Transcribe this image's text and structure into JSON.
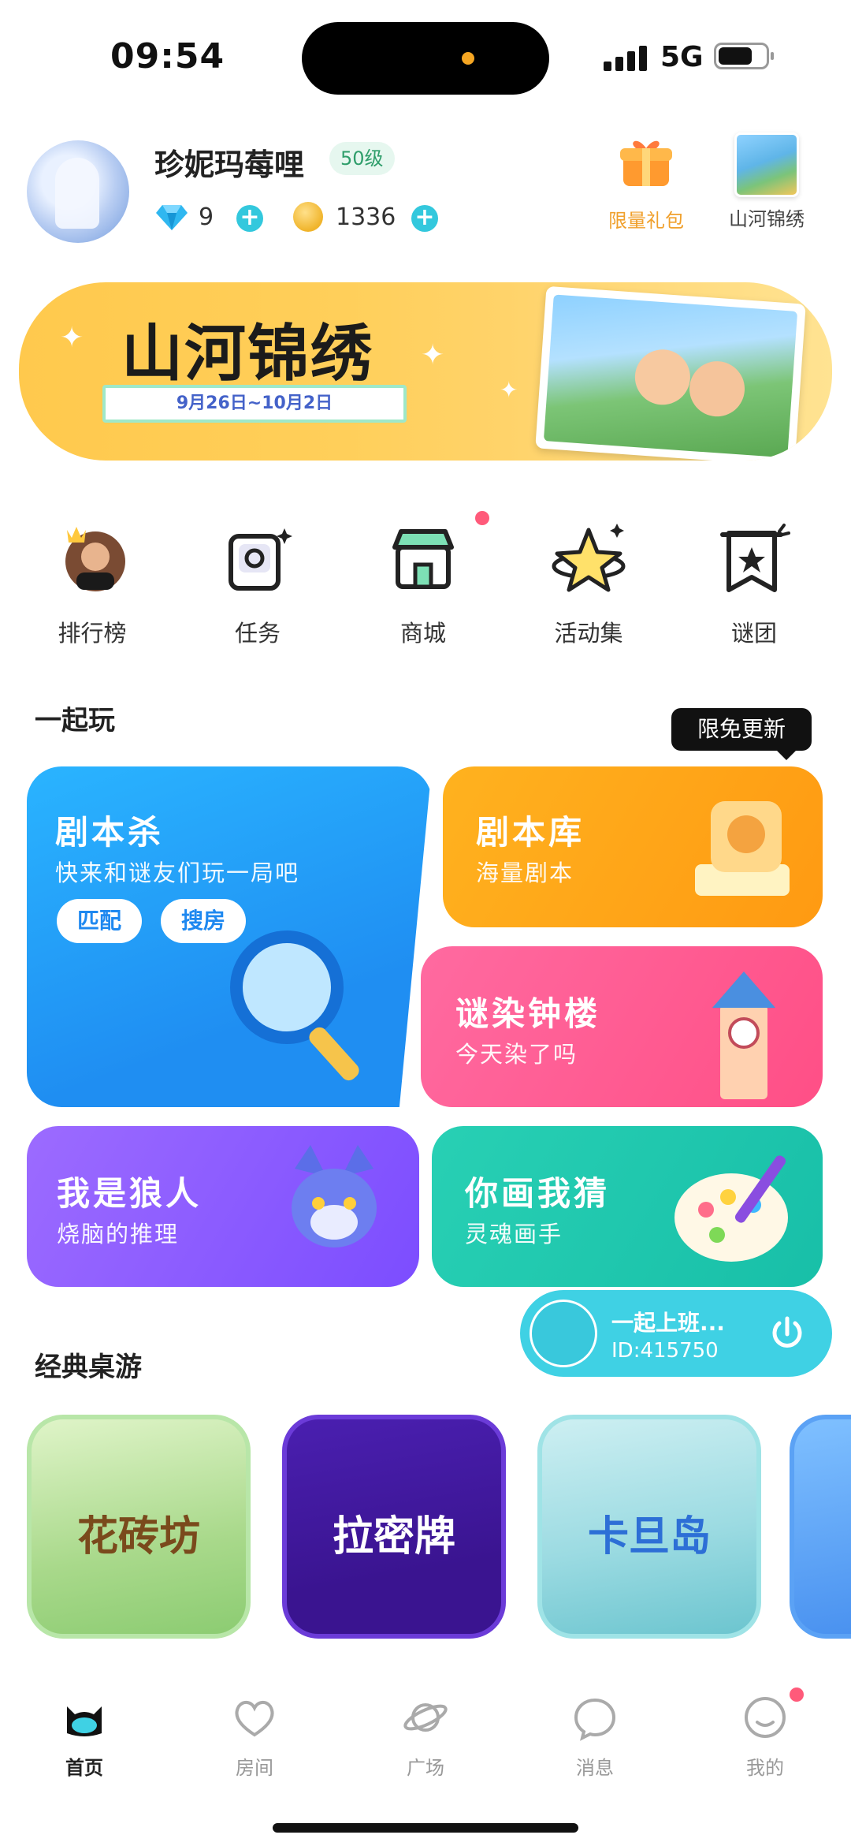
{
  "status_bar": {
    "time": "09:54",
    "network": "5G"
  },
  "profile": {
    "username": "珍妮玛莓哩",
    "level": "50级",
    "gems": "9",
    "coins": "1336",
    "gift_label": "限量礼包",
    "event_label": "山河锦绣"
  },
  "banner": {
    "title": "山河锦绣",
    "date_range": "9月26日~10月2日"
  },
  "quick_links": [
    {
      "label": "排行榜"
    },
    {
      "label": "任务"
    },
    {
      "label": "商城"
    },
    {
      "label": "活动集"
    },
    {
      "label": "谜团"
    }
  ],
  "play_together": {
    "title": "一起玩",
    "tooltip": "限免更新",
    "script_kill": {
      "title": "剧本杀",
      "subtitle": "快来和谜友们玩一局吧",
      "match_label": "匹配",
      "search_label": "搜房"
    },
    "script_library": {
      "title": "剧本库",
      "subtitle": "海量剧本"
    },
    "clock_tower": {
      "title": "谜染钟楼",
      "subtitle": "今天染了吗"
    },
    "werewolf": {
      "title": "我是狼人",
      "subtitle": "烧脑的推理"
    },
    "draw_guess": {
      "title": "你画我猜",
      "subtitle": "灵魂画手"
    }
  },
  "floating_room": {
    "name": "一起上班...",
    "id": "ID:415750"
  },
  "classic": {
    "title": "经典桌游",
    "games": [
      {
        "name": "花砖坊"
      },
      {
        "name": "拉密牌"
      },
      {
        "name": "卡旦岛"
      }
    ]
  },
  "tabs": [
    {
      "label": "首页",
      "active": true
    },
    {
      "label": "房间"
    },
    {
      "label": "广场"
    },
    {
      "label": "消息"
    },
    {
      "label": "我的"
    }
  ],
  "colors": {
    "accent": "#3fd1e4",
    "script_kill": "#2b9cf2",
    "script_library": "#ffa41f",
    "clock_tower": "#ff5d92",
    "werewolf": "#8b5cf6",
    "draw_guess": "#22c7b0"
  }
}
